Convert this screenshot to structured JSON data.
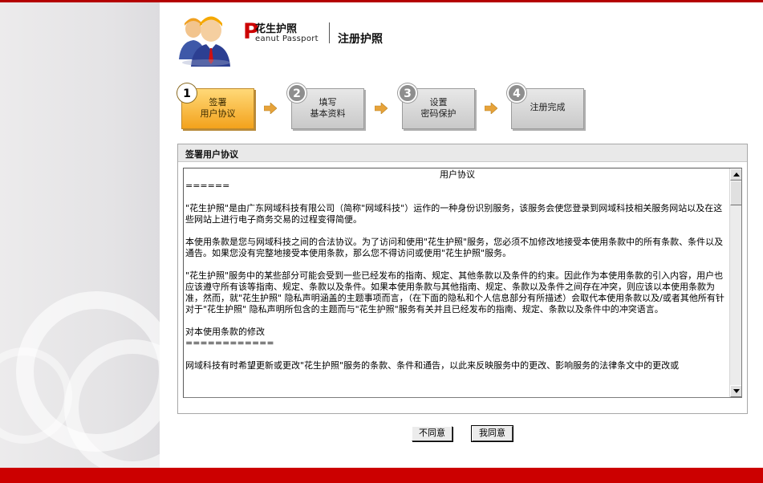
{
  "header": {
    "logo_p": "P",
    "logo_cn": "花生护照",
    "logo_en": "eanut Passport",
    "page_title": "注册护照"
  },
  "steps": [
    {
      "num": "1",
      "line1": "签署",
      "line2": "用户协议",
      "active": true
    },
    {
      "num": "2",
      "line1": "填写",
      "line2": "基本资料",
      "active": false
    },
    {
      "num": "3",
      "line1": "设置",
      "line2": "密码保护",
      "active": false
    },
    {
      "num": "4",
      "line1": "注册完成",
      "line2": "",
      "active": false
    }
  ],
  "panel": {
    "title": "签署用户协议",
    "agreement": {
      "heading": "用户协议",
      "line_sep1": "======",
      "para1": "\"花生护照\"是由广东网域科技有限公司（简称\"网域科技\"）运作的一种身份识别服务，该服务会使您登录到网域科技相关服务网站以及在这些网站上进行电子商务交易的过程变得简便。",
      "para2": "本使用条款是您与网域科技之间的合法协议。为了访问和使用\"花生护照\"服务，您必须不加修改地接受本使用条款中的所有条款、条件以及通告。如果您没有完整地接受本使用条款，那么您不得访问或使用\"花生护照\"服务。",
      "para3": "\"花生护照\"服务中的某些部分可能会受到一些已经发布的指南、规定、其他条款以及条件的约束。因此作为本使用条款的引入内容，用户也应该遵守所有该等指南、规定、条款以及条件。如果本使用条款与其他指南、规定、条款以及条件之间存在冲突，则应该以本使用条款为准，然而，就\"花生护照\" 隐私声明涵盖的主题事项而言，（在下面的隐私和个人信息部分有所描述）会取代本使用条款以及/或者其他所有针对于\"花生护照\" 隐私声明所包含的主题而与\"花生护照\"服务有关并且已经发布的指南、规定、条款以及条件中的冲突语言。",
      "sub_heading": "对本使用条款的修改",
      "line_sep2": "============",
      "para4": "网域科技有时希望更新或更改\"花生护照\"服务的条款、条件和通告，以此来反映服务中的更改、影响服务的法律条文中的更改或"
    }
  },
  "buttons": {
    "disagree": "不同意",
    "agree": "我同意"
  },
  "colors": {
    "brand_red": "#cc0000",
    "active_step": "#f3a21c"
  }
}
